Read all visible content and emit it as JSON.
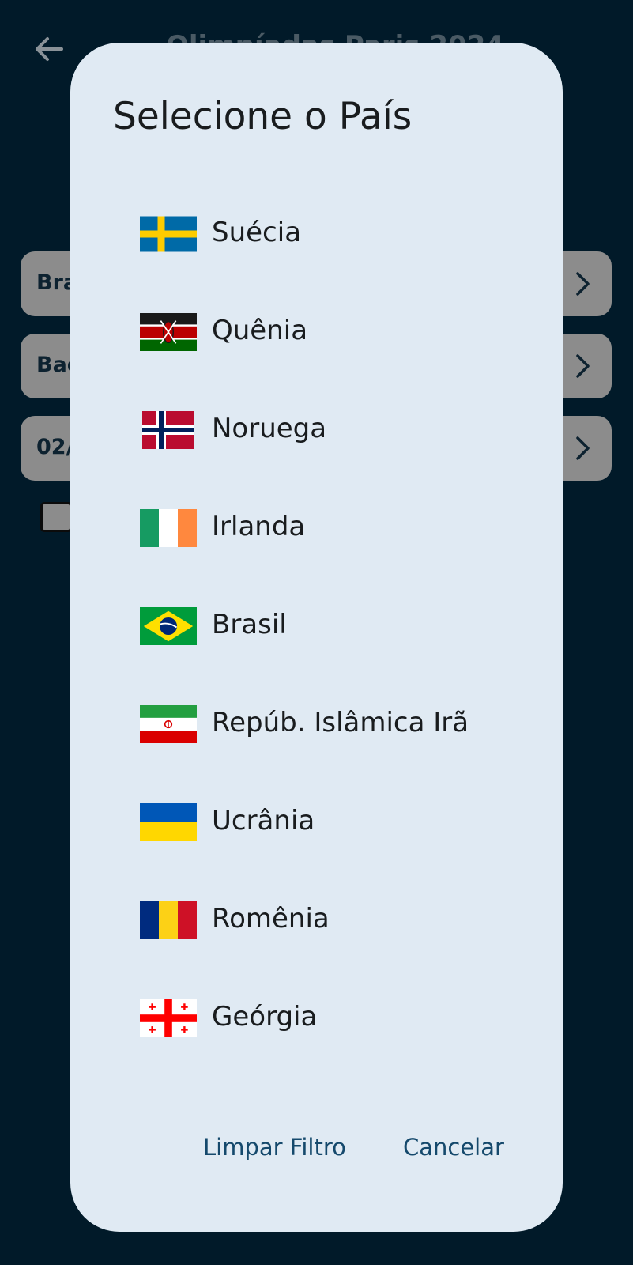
{
  "background": {
    "title": "Olimpíadas Paris 2024",
    "rows": [
      {
        "label": "Bra"
      },
      {
        "label": "Bad"
      },
      {
        "label": "02/"
      }
    ]
  },
  "dialog": {
    "title": "Selecione o País",
    "countries": [
      {
        "name": "Suécia",
        "flag": "sweden-flag"
      },
      {
        "name": "Quênia",
        "flag": "kenya-flag"
      },
      {
        "name": "Noruega",
        "flag": "norway-flag"
      },
      {
        "name": "Irlanda",
        "flag": "ireland-flag"
      },
      {
        "name": "Brasil",
        "flag": "brazil-flag"
      },
      {
        "name": "Repúb. Islâmica Irã",
        "flag": "iran-flag"
      },
      {
        "name": "Ucrânia",
        "flag": "ukraine-flag"
      },
      {
        "name": "Romênia",
        "flag": "romania-flag"
      },
      {
        "name": "Geórgia",
        "flag": "georgia-flag"
      }
    ],
    "clear_label": "Limpar Filtro",
    "cancel_label": "Cancelar"
  },
  "colors": {
    "app_background": "#011a29",
    "dialog_background": "#e0eaf3",
    "action_text": "#15496c"
  }
}
